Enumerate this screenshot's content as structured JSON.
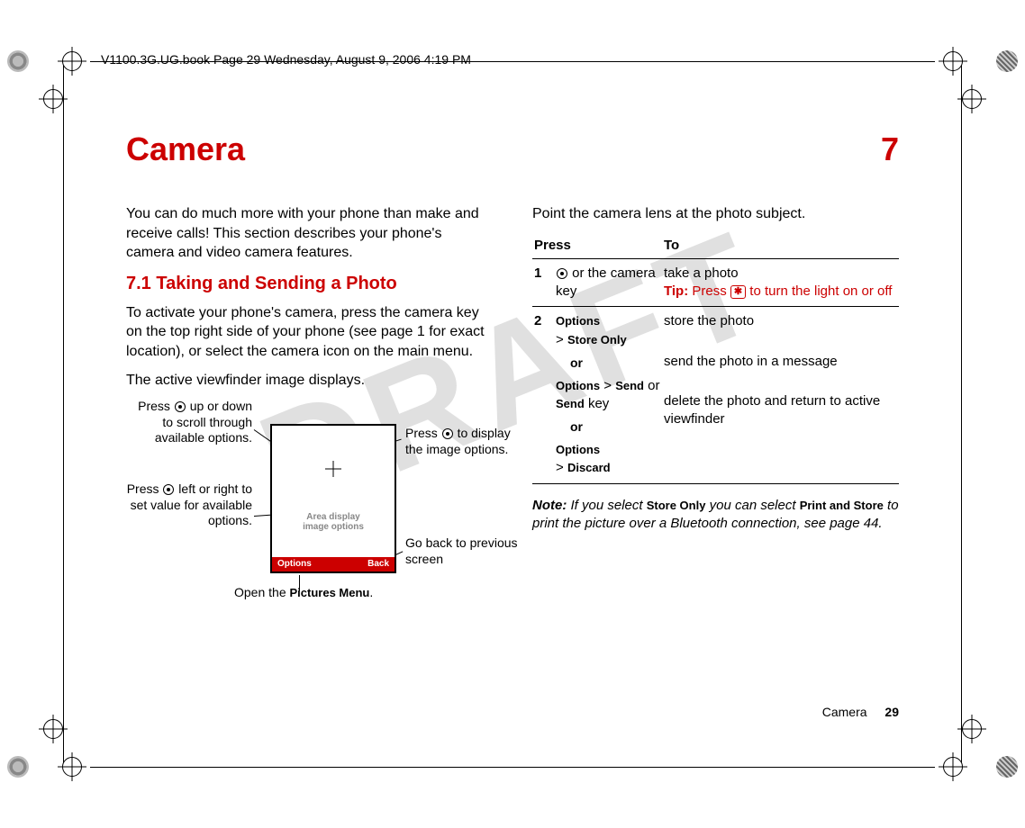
{
  "header_path": "V1100.3G.UG.book  Page 29  Wednesday, August 9, 2006  4:19 PM",
  "watermark": "DRAFT",
  "chapter": {
    "title": "Camera",
    "number": "7"
  },
  "left": {
    "intro": "You can do much more with your phone than make and receive calls! This section describes your phone's camera and video camera features.",
    "h2": "7.1 Taking and Sending a Photo",
    "p1": "To activate your phone's camera, press the camera key on the top right side of your phone (see page 1 for exact location), or select the camera icon on the main menu.",
    "p2": "The active viewfinder image displays.",
    "diagram": {
      "c_updown_pre": "Press ",
      "c_updown_post": " up or down to scroll through available options.",
      "c_leftright_pre": "Press ",
      "c_leftright_post": " left or right to set value for available options.",
      "c_display_pre": "Press ",
      "c_display_post": " to display the image options.",
      "c_back": "Go back to previous screen",
      "area_l1": "Area display",
      "area_l2": "image options",
      "soft_left": "Options",
      "soft_right": "Back",
      "open_pre": "Open the ",
      "open_menu": "Pictures Menu",
      "open_post": "."
    }
  },
  "right": {
    "lead": "Point the camera lens at the photo subject.",
    "th_press": "Press",
    "th_to": "To",
    "rows": {
      "r1": {
        "step": "1",
        "press_post": " or the camera key",
        "to": "take a photo",
        "tip_lead": "Tip:",
        "tip_pre": " Press ",
        "tip_key": "✱",
        "tip_post": " to turn the light on or off"
      },
      "r2": {
        "step": "2",
        "a_menu1": "Options",
        "a_sep": " > ",
        "a_menu2": "Store Only",
        "a_to": "store the photo",
        "or": "or",
        "b_menu1": "Options",
        "b_sep": " > ",
        "b_menu2": "Send",
        "b_mid": " or ",
        "b_menu3": "Send",
        "b_post": " key",
        "b_to": "send the photo in a message",
        "c_menu1": "Options",
        "c_sep": " > ",
        "c_menu2": "Discard",
        "c_to": "delete the photo and return to active viewfinder"
      }
    },
    "note": {
      "lead": "Note:",
      "pre": " If you select ",
      "m1": "Store Only",
      "mid": " you can select ",
      "m2": "Print and Store",
      "post": " to print the picture over a Bluetooth connection, see page 44."
    }
  },
  "footer": {
    "section": "Camera",
    "page": "29"
  }
}
